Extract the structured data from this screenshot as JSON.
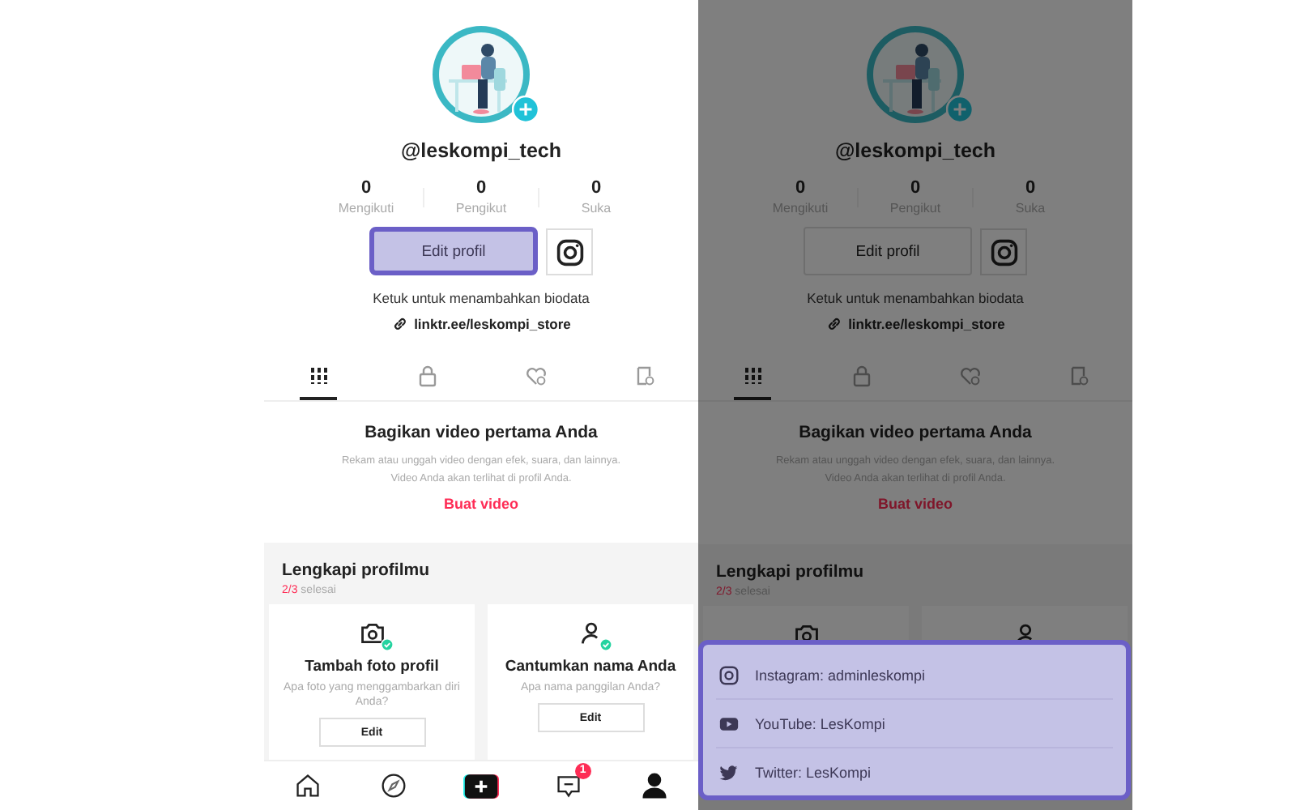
{
  "screens": [
    {
      "dimmed": false,
      "avatar": {
        "kind": "picture"
      },
      "username": "@leskompi_tech",
      "stats": [
        {
          "value": "0",
          "label": "Mengikuti"
        },
        {
          "value": "0",
          "label": "Pengikut"
        },
        {
          "value": "0",
          "label": "Suka"
        }
      ],
      "edit_button": {
        "label": "Edit profil",
        "highlighted": true
      },
      "bio_prompt": "Ketuk untuk menambahkan biodata",
      "link": "linktr.ee/leskompi_store",
      "tabs": [
        {
          "kind": "grid",
          "selected": true
        },
        {
          "kind": "lock",
          "selected": false
        },
        {
          "kind": "heart",
          "selected": false
        },
        {
          "kind": "tag",
          "selected": false
        }
      ],
      "empty_state": {
        "title": "Bagikan video pertama Anda",
        "description_lines": [
          "Rekam atau unggah video dengan efek, suara, dan lainnya.",
          "Video Anda akan terlihat di profil Anda."
        ],
        "action": "Buat video"
      },
      "complete": {
        "title": "Lengkapi profilmu",
        "progress_count": "2/3",
        "progress_label": "selesai",
        "cards": [
          {
            "kind": "camera",
            "done": true,
            "title": "Tambah foto profil",
            "question": "Apa foto yang menggambarkan diri Anda?",
            "button": "Edit"
          },
          {
            "kind": "person",
            "done": true,
            "title": "Cantumkan nama Anda",
            "question": "Apa nama panggilan Anda?",
            "button": "Edit"
          }
        ]
      },
      "nav": [
        {
          "kind": "home",
          "selected": false
        },
        {
          "kind": "discover",
          "selected": false
        },
        {
          "kind": "create",
          "selected": false
        },
        {
          "kind": "inbox",
          "selected": false,
          "badge": "1"
        },
        {
          "kind": "profile",
          "selected": true
        }
      ]
    },
    {
      "dimmed": true,
      "avatar": {
        "kind": "picture"
      },
      "username": "@leskompi_tech",
      "stats": [
        {
          "value": "0",
          "label": "Mengikuti"
        },
        {
          "value": "0",
          "label": "Pengikut"
        },
        {
          "value": "0",
          "label": "Suka"
        }
      ],
      "edit_button": {
        "label": "Edit profil",
        "highlighted": false
      },
      "bio_prompt": "Ketuk untuk menambahkan biodata",
      "link": "linktr.ee/leskompi_store",
      "tabs": [
        {
          "kind": "grid",
          "selected": true
        },
        {
          "kind": "lock",
          "selected": false
        },
        {
          "kind": "heart",
          "selected": false
        },
        {
          "kind": "tag",
          "selected": false
        }
      ],
      "empty_state": {
        "title": "Bagikan video pertama Anda",
        "description_lines": [
          "Rekam atau unggah video dengan efek, suara, dan lainnya.",
          "Video Anda akan terlihat di profil Anda."
        ],
        "action": "Buat video"
      },
      "complete": {
        "title": "Lengkapi profilmu",
        "progress_count": "2/3",
        "progress_label": "selesai",
        "cards": [
          {
            "kind": "camera"
          },
          {
            "kind": "person"
          }
        ]
      },
      "sheet": {
        "highlighted": true,
        "items": [
          {
            "kind": "instagram",
            "label": "Instagram: adminleskompi"
          },
          {
            "kind": "youtube",
            "label": "YouTube: LesKompi"
          },
          {
            "kind": "twitter",
            "label": "Twitter: LesKompi"
          }
        ]
      }
    }
  ]
}
